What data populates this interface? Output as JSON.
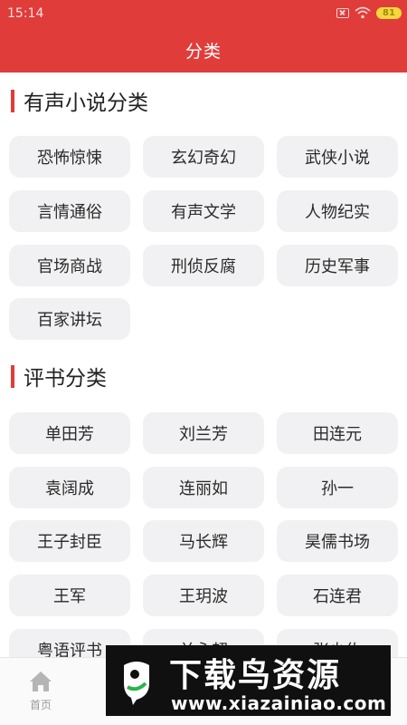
{
  "status_bar": {
    "time": "15:14",
    "battery": "81"
  },
  "header": {
    "title": "分类"
  },
  "sections": [
    {
      "title": "有声小说分类",
      "items": [
        "恐怖惊悚",
        "玄幻奇幻",
        "武侠小说",
        "言情通俗",
        "有声文学",
        "人物纪实",
        "官场商战",
        "刑侦反腐",
        "历史军事",
        "百家讲坛"
      ]
    },
    {
      "title": "评书分类",
      "items": [
        "单田芳",
        "刘兰芳",
        "田连元",
        "袁阔成",
        "连丽如",
        "孙一",
        "王子封臣",
        "马长辉",
        "昊儒书场",
        "王军",
        "王玥波",
        "石连君",
        "粤语评书",
        "关永超",
        "张少佐"
      ]
    }
  ],
  "bottom_nav": {
    "home_label": "首页"
  },
  "watermark": {
    "title": "下载鸟资源",
    "url": "www.xiazainiao.com"
  },
  "colors": {
    "accent": "#e03c3a",
    "tag_bg": "#f1f1f3"
  }
}
